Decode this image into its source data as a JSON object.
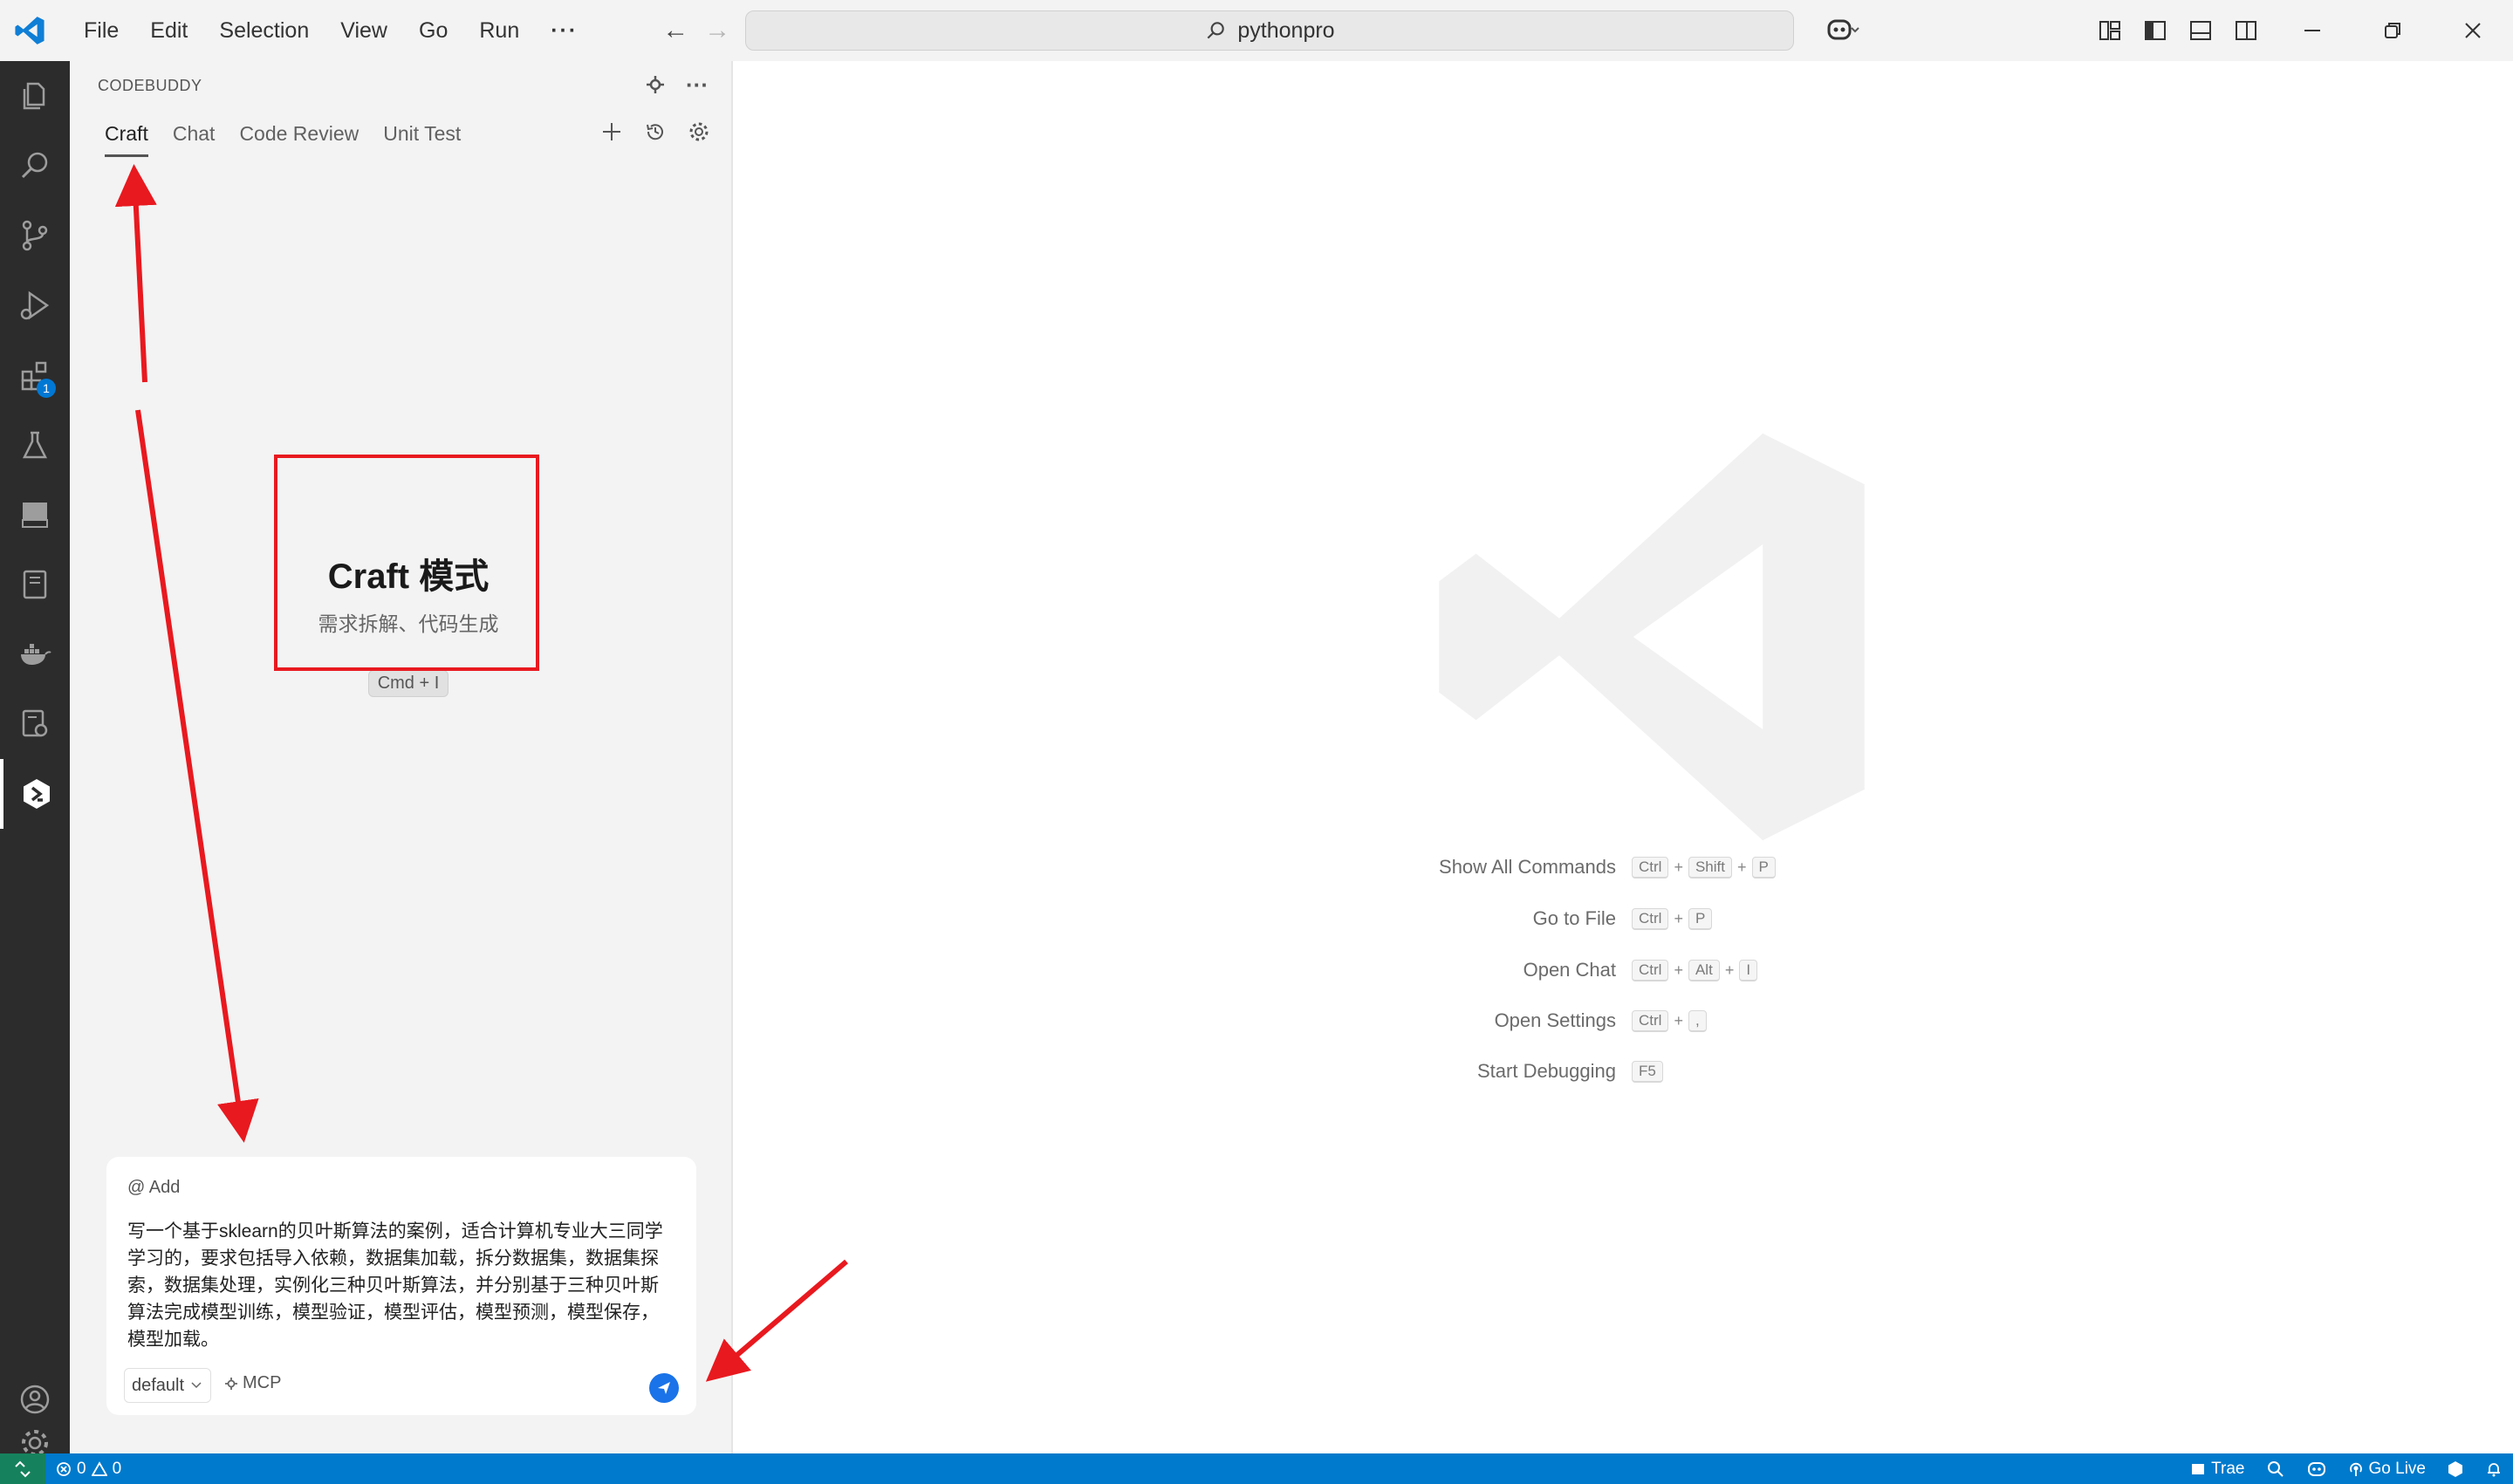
{
  "titlebar": {
    "menus": [
      "File",
      "Edit",
      "Selection",
      "View",
      "Go",
      "Run"
    ],
    "more": "···",
    "search": "pythonpro"
  },
  "sidebar": {
    "title": "CODEBUDDY",
    "tabs": [
      "Craft",
      "Chat",
      "Code Review",
      "Unit Test"
    ],
    "craft": {
      "title": "Craft 模式",
      "subtitle": "需求拆解、代码生成",
      "shortcut": "Cmd + I"
    },
    "chat": {
      "add": "@ Add",
      "prompt": "写一个基于sklearn的贝叶斯算法的案例，适合计算机专业大三同学学习的，要求包括导入依赖，数据集加载，拆分数据集，数据集探索，数据集处理，实例化三种贝叶斯算法，并分别基于三种贝叶斯算法完成模型训练，模型验证，模型评估，模型预测，模型保存，模型加载。",
      "model": "default",
      "mcp": "MCP"
    }
  },
  "activity_badge": "1",
  "editor": {
    "shortcuts": [
      {
        "label": "Show All Commands",
        "keys": [
          "Ctrl",
          "Shift",
          "P"
        ]
      },
      {
        "label": "Go to File",
        "keys": [
          "Ctrl",
          "P"
        ]
      },
      {
        "label": "Open Chat",
        "keys": [
          "Ctrl",
          "Alt",
          "I"
        ]
      },
      {
        "label": "Open Settings",
        "keys": [
          "Ctrl",
          ","
        ]
      },
      {
        "label": "Start Debugging",
        "keys": [
          "F5"
        ]
      }
    ],
    "plus": "+"
  },
  "statusbar": {
    "errors": "0",
    "warnings": "0",
    "trae": "Trae",
    "golive": "Go Live"
  },
  "colors": {
    "accent": "#007acc",
    "annotation": "#e8191f",
    "activitybar": "#2c2c2c"
  }
}
